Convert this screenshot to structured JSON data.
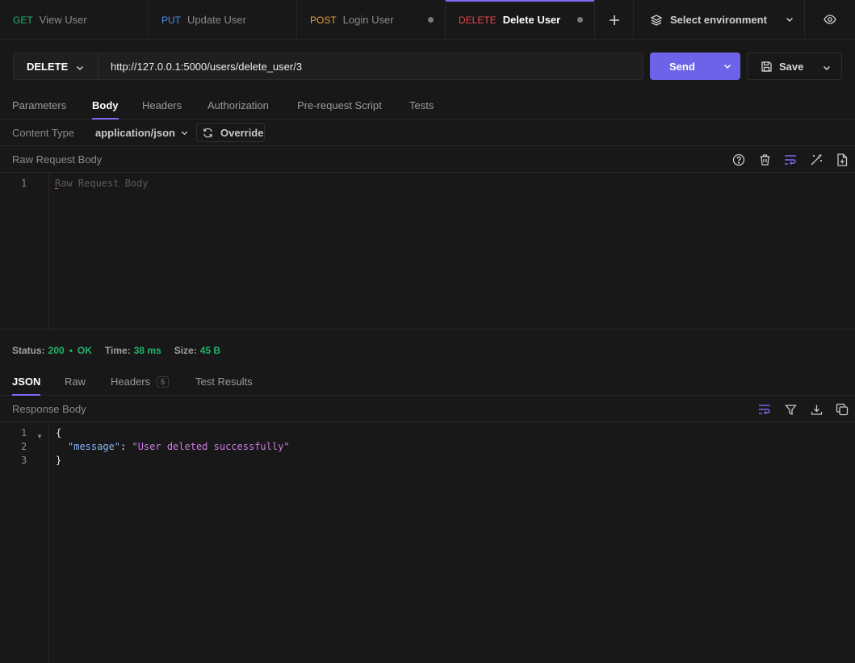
{
  "tabs": [
    {
      "method": "GET",
      "title": "View User",
      "color": "#21b36b",
      "unsaved": false,
      "active": false
    },
    {
      "method": "PUT",
      "title": "Update User",
      "color": "#4a90e2",
      "unsaved": false,
      "active": false
    },
    {
      "method": "POST",
      "title": "Login User",
      "color": "#e5a03a",
      "unsaved": true,
      "active": false
    },
    {
      "method": "DELETE",
      "title": "Delete User",
      "color": "#e5484d",
      "unsaved": true,
      "active": true
    }
  ],
  "new_tab_icon": "plus-icon",
  "environment": {
    "label": "Select environment"
  },
  "request": {
    "method": "DELETE",
    "url": "http://127.0.0.1:5000/users/delete_user/3",
    "send_label": "Send",
    "save_label": "Save"
  },
  "request_tabs": [
    "Parameters",
    "Body",
    "Headers",
    "Authorization",
    "Pre-request Script",
    "Tests"
  ],
  "active_request_tab": "Body",
  "content_type": {
    "label": "Content Type",
    "value": "application/json",
    "override_label": "Override"
  },
  "request_body": {
    "label": "Raw Request Body",
    "line_number": "1",
    "placeholder": "Raw Request Body"
  },
  "response": {
    "status_label": "Status:",
    "status_code": "200",
    "status_text": "OK",
    "time_label": "Time:",
    "time_value": "38 ms",
    "size_label": "Size:",
    "size_value": "45 B",
    "tabs": [
      "JSON",
      "Raw",
      "Headers",
      "Test Results"
    ],
    "headers_count": "5",
    "body_label": "Response Body",
    "lines": [
      "1",
      "2",
      "3"
    ],
    "open_brace": "{",
    "key": "\"message\"",
    "colon": ": ",
    "value": "\"User deleted successfully\"",
    "close_brace": "}"
  },
  "colors": {
    "accent": "#6b63e8",
    "success": "#21b36b",
    "delete": "#e5484d"
  }
}
